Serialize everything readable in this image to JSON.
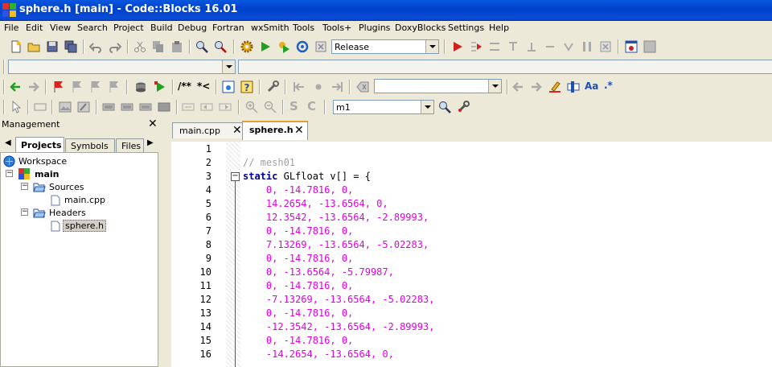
{
  "window": {
    "title": "sphere.h [main] - Code::Blocks 16.01"
  },
  "menu": [
    "File",
    "Edit",
    "View",
    "Search",
    "Project",
    "Build",
    "Debug",
    "Fortran",
    "wxSmith",
    "Tools",
    "Tools+",
    "Plugins",
    "DoxyBlocks",
    "Settings",
    "Help"
  ],
  "toolbar": {
    "build_target": "Release",
    "search_combo": "m1"
  },
  "management": {
    "title": "Management",
    "tabs": [
      "Projects",
      "Symbols",
      "Files"
    ],
    "tree": {
      "workspace": "Workspace",
      "project": "main",
      "sources": "Sources",
      "source_file": "main.cpp",
      "headers": "Headers",
      "header_file": "sphere.h"
    }
  },
  "editor": {
    "tabs": [
      {
        "label": "main.cpp",
        "active": false
      },
      {
        "label": "sphere.h",
        "active": true
      }
    ],
    "lines": [
      {
        "n": "1",
        "text": "",
        "color": "#000000"
      },
      {
        "n": "2",
        "text": "// mesh01",
        "color": "#a0a0a0"
      },
      {
        "n": "3",
        "text": "static GLfloat v[] = {",
        "color": "#000000"
      },
      {
        "n": "4",
        "text": "    0, -14.7816, 0,",
        "color": "#e000e0"
      },
      {
        "n": "5",
        "text": "    14.2654, -13.6564, 0,",
        "color": "#e000e0"
      },
      {
        "n": "6",
        "text": "    12.3542, -13.6564, -2.89993,",
        "color": "#e000e0"
      },
      {
        "n": "7",
        "text": "    0, -14.7816, 0,",
        "color": "#e000e0"
      },
      {
        "n": "8",
        "text": "    7.13269, -13.6564, -5.02283,",
        "color": "#e000e0"
      },
      {
        "n": "9",
        "text": "    0, -14.7816, 0,",
        "color": "#e000e0"
      },
      {
        "n": "10",
        "text": "    0, -13.6564, -5.79987,",
        "color": "#e000e0"
      },
      {
        "n": "11",
        "text": "    0, -14.7816, 0,",
        "color": "#e000e0"
      },
      {
        "n": "12",
        "text": "    -7.13269, -13.6564, -5.02283,",
        "color": "#e000e0"
      },
      {
        "n": "13",
        "text": "    0, -14.7816, 0,",
        "color": "#e000e0"
      },
      {
        "n": "14",
        "text": "    -12.3542, -13.6564, -2.89993,",
        "color": "#e000e0"
      },
      {
        "n": "15",
        "text": "    0, -14.7816, 0,",
        "color": "#e000e0"
      },
      {
        "n": "16",
        "text": "    -14.2654, -13.6564, 0,",
        "color": "#e000e0"
      }
    ]
  }
}
